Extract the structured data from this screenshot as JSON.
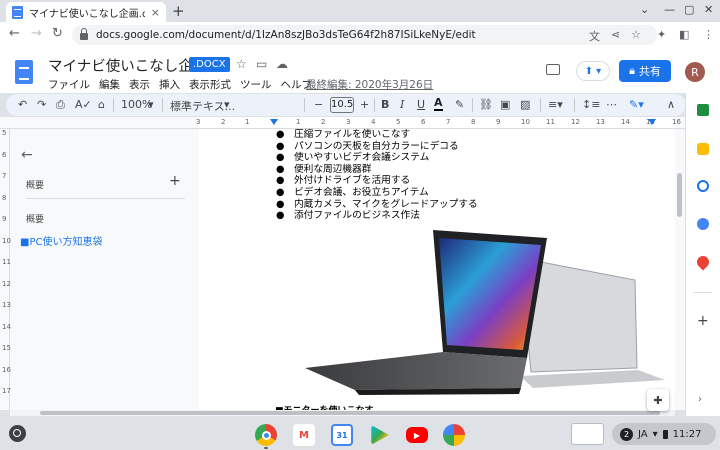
{
  "browser": {
    "tab_title": "マイナビ使いこなし企画.docx",
    "url": "docs.google.com/document/d/1IzAn8szJBo3dsTeG64f2h87ISiLkeNyE/edit",
    "new_tab_glyph": "+",
    "tab_close_glyph": "×"
  },
  "doc": {
    "title": "マイナビ使いこなし企画",
    "badge": ".DOCX",
    "menus": [
      "ファイル",
      "編集",
      "表示",
      "挿入",
      "表示形式",
      "ツール",
      "ヘルプ"
    ],
    "last_edit": "最終編集: 2020年3月26日",
    "share_label": "共有",
    "avatar_initial": "R"
  },
  "toolbar": {
    "zoom": "100%",
    "style": "標準テキス...",
    "font_size": "10.5"
  },
  "ruler": [
    "3",
    "2",
    "1",
    "1",
    "2",
    "3",
    "4",
    "5",
    "6",
    "7",
    "8",
    "9",
    "10",
    "11",
    "12",
    "13",
    "14",
    "15",
    "16"
  ],
  "vruler": [
    "5",
    "6",
    "7",
    "8",
    "9",
    "10",
    "11",
    "12",
    "13",
    "14",
    "15",
    "16",
    "17"
  ],
  "sidebar": {
    "summary_label": "概要",
    "outline_label": "概要",
    "outline_items": [
      "■PC使い方知恵袋"
    ]
  },
  "document": {
    "bullet_glyph": "●",
    "bullets": [
      "圧縮ファイルを使いこなす",
      "パソコンの天板を自分カラーにデコる",
      "使いやすいビデオ会議システム",
      "便利な周辺機器群",
      "外付けドライブを活用する",
      "ビデオ会議、お役立ちアイテム",
      "内蔵カメラ、マイクをグレードアップする",
      "添付ファイルのビジネス作法"
    ],
    "next_heading_partial": "■モニターを使いこなす",
    "image_alt": "laptop-photo"
  },
  "shelf": {
    "apps": [
      "chrome",
      "gmail",
      "calendar",
      "play-store",
      "youtube",
      "photos"
    ],
    "notification_count": "2",
    "ime": "JA",
    "time": "11:27"
  },
  "colors": {
    "accent": "#1a73e8",
    "docs_blue": "#4285f4"
  }
}
